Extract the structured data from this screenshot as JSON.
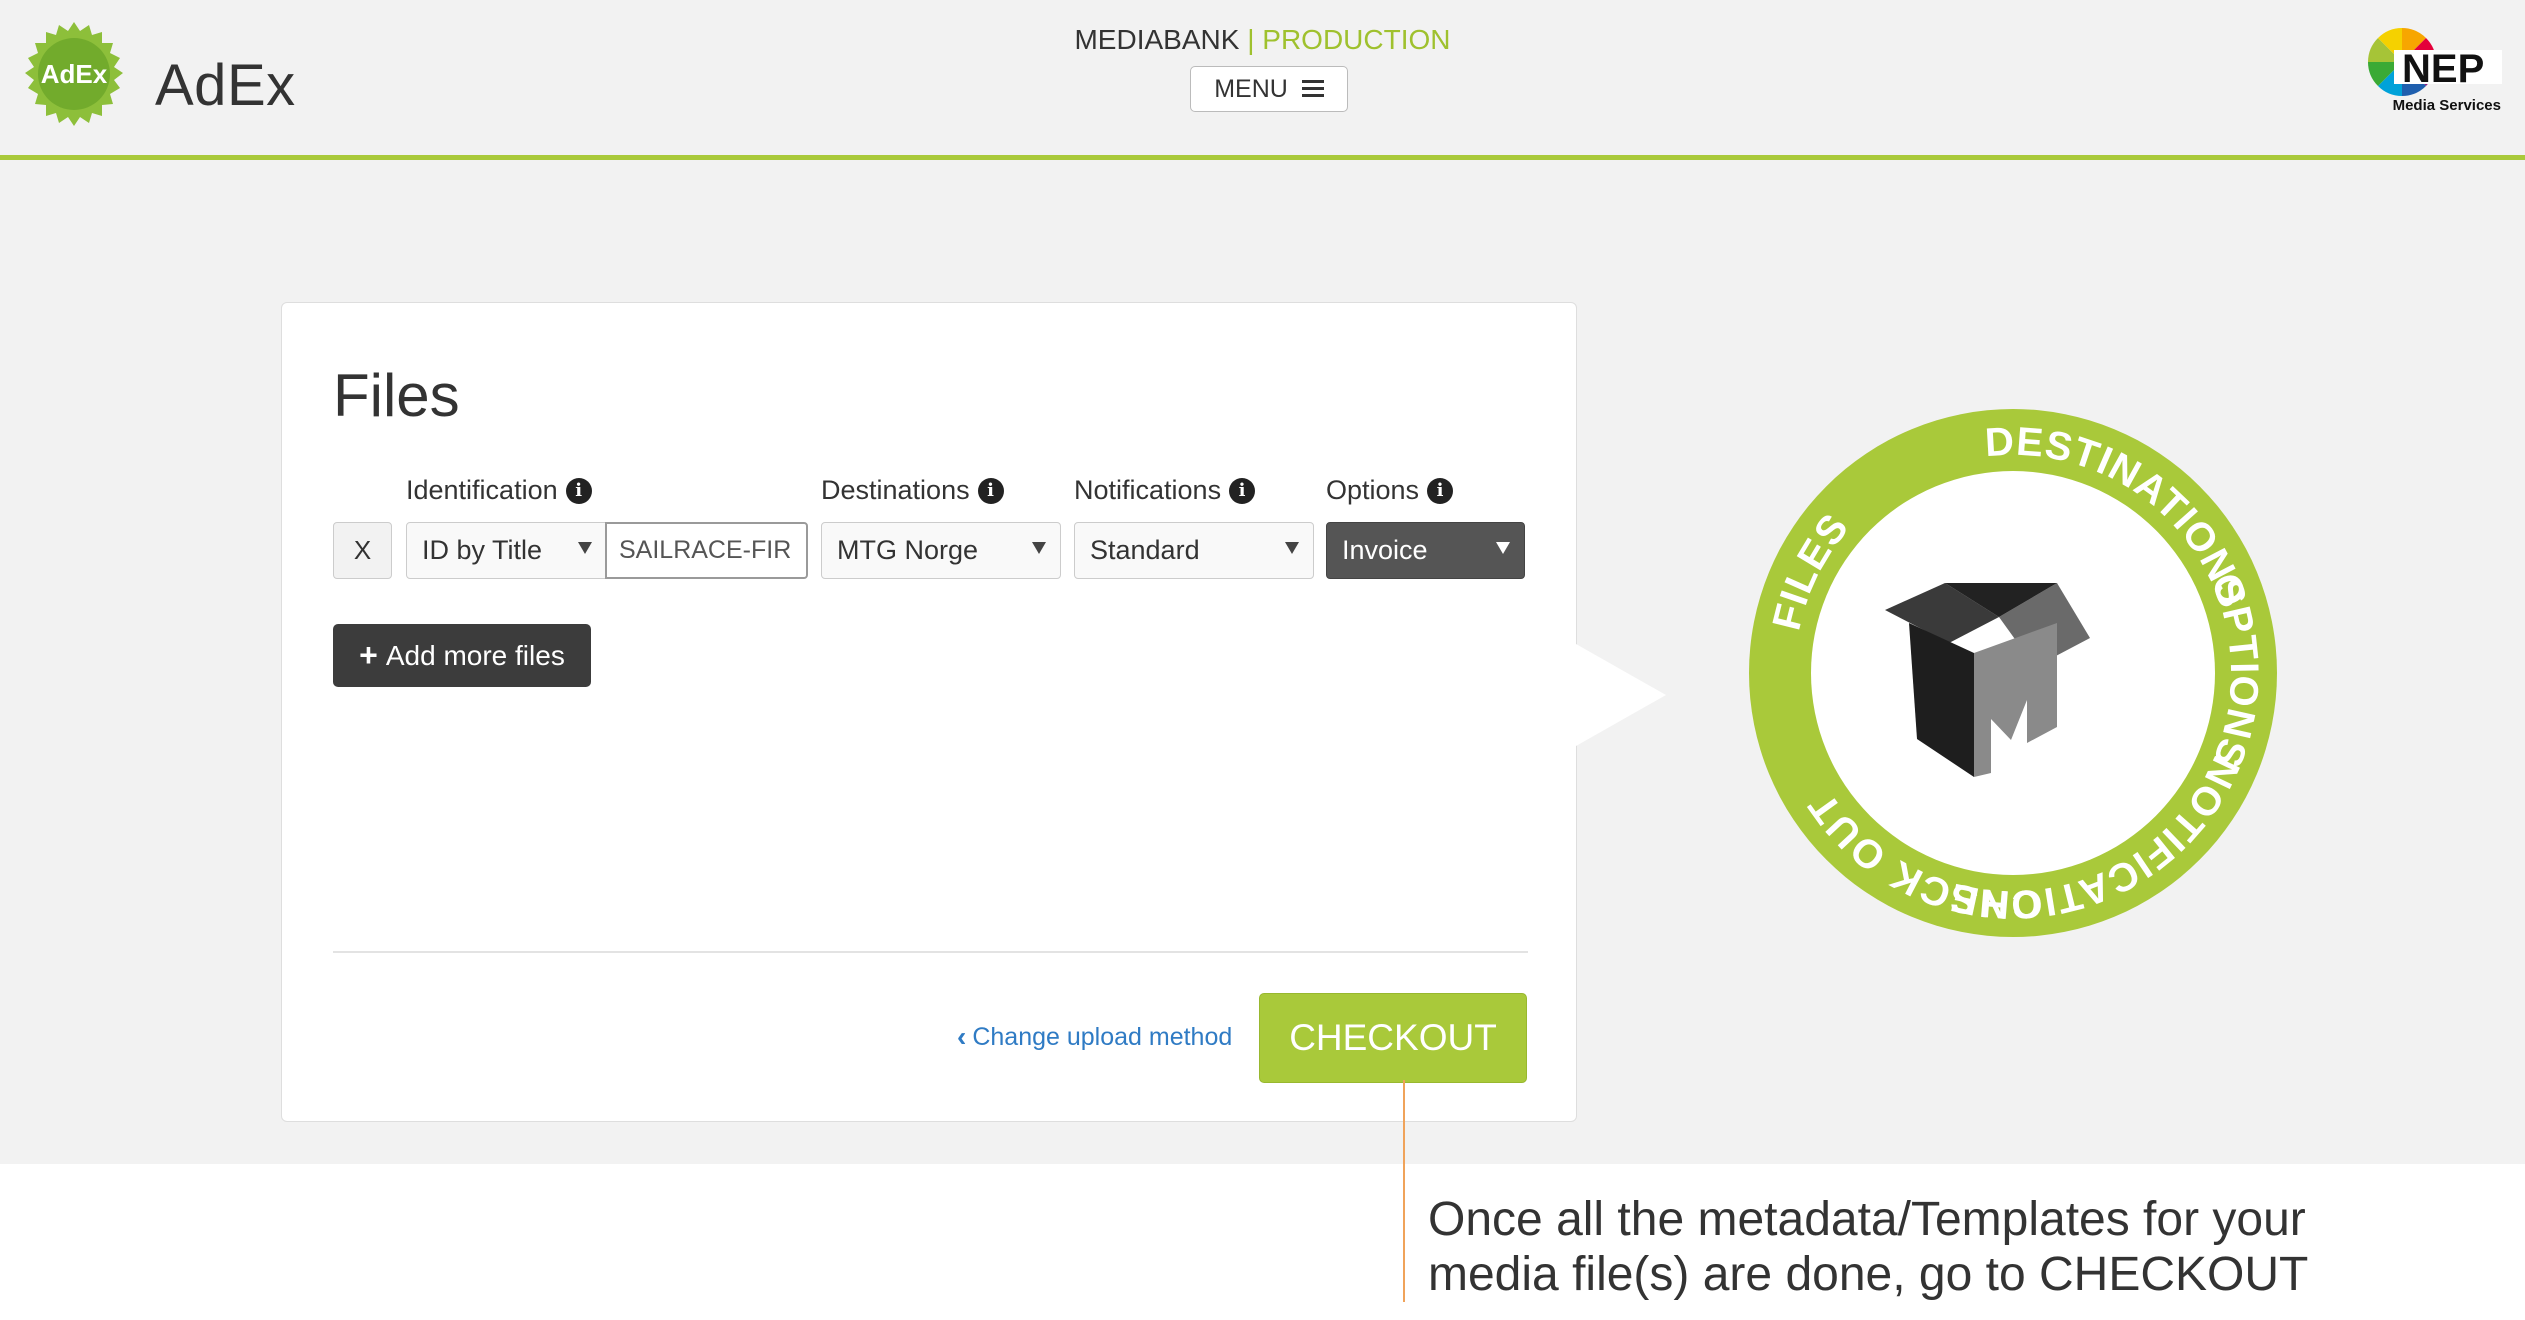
{
  "header": {
    "app_name": "AdEx",
    "logo_text": "AdEx",
    "env_left": "MEDIABANK",
    "env_sep": "|",
    "env_right": "PRODUCTION",
    "menu_label": "MENU",
    "partner_logo": {
      "name": "NEP",
      "subtitle": "Media Services"
    }
  },
  "files_card": {
    "title": "Files",
    "labels": {
      "identification": "Identification",
      "destinations": "Destinations",
      "notifications": "Notifications",
      "options": "Options"
    },
    "row": {
      "remove_label": "X",
      "id_method": "ID by Title",
      "id_value": "SAILRACE-FIR",
      "destination": "MTG Norge",
      "notification": "Standard",
      "option": "Invoice"
    },
    "add_more_label": "Add more files",
    "change_method_label": "Change upload method",
    "checkout_label": "CHECKOUT"
  },
  "workflow_wheel": {
    "segments": [
      "DESTINATIONS",
      "OPTIONS",
      "NOTIFICATIONS",
      "CHECK OUT",
      "FILES"
    ]
  },
  "annotation": {
    "line1": "Once all the metadata/Templates for your",
    "line2": "media file(s) are done, go to CHECKOUT"
  },
  "colors": {
    "brand_green": "#a9c93a",
    "link_blue": "#2f7bc4",
    "guide_orange": "#f0a35a"
  }
}
